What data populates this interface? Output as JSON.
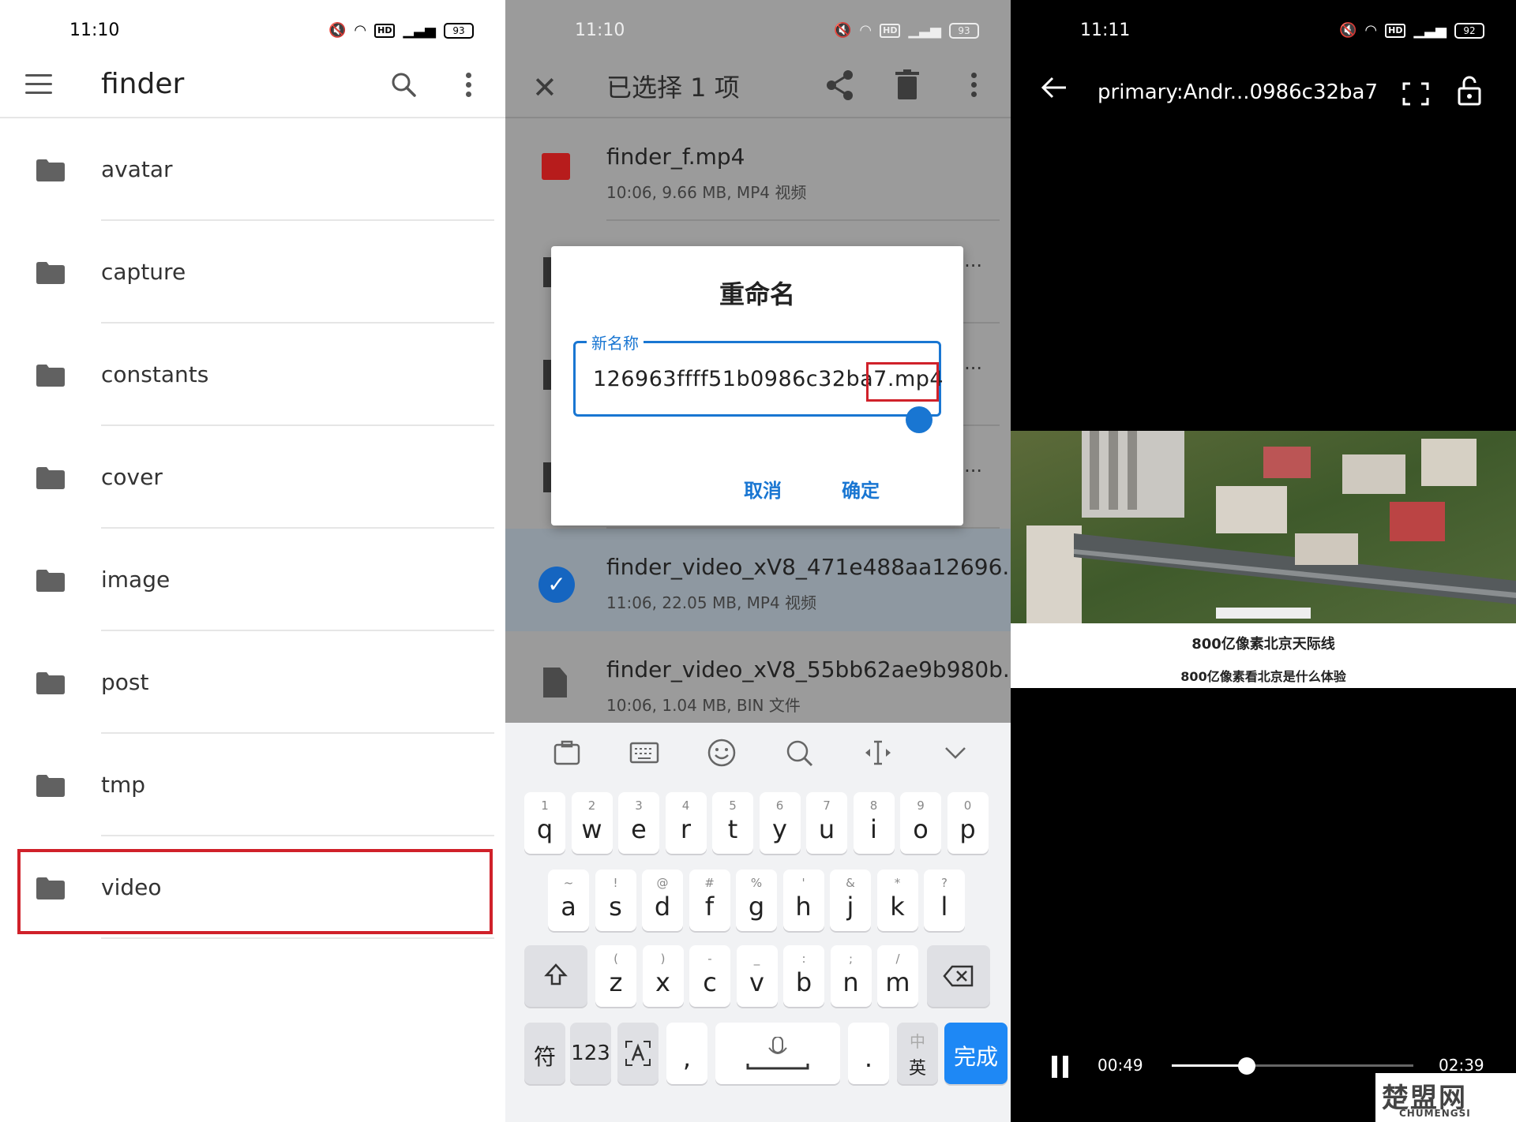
{
  "colors": {
    "accent": "#1976d2",
    "highlight": "#d0212a",
    "done_key": "#1e88f5"
  },
  "left": {
    "status": {
      "time": "11:10",
      "battery": "93"
    },
    "toolbar": {
      "title": "finder",
      "menu_icon": "hamburger-icon",
      "search_icon": "search-icon",
      "more_icon": "more-vert-icon"
    },
    "folders": [
      "avatar",
      "capture",
      "constants",
      "cover",
      "image",
      "post",
      "tmp",
      "video"
    ]
  },
  "middle": {
    "status": {
      "time": "11:10",
      "battery": "93"
    },
    "toolbar": {
      "title": "已选择 1 项"
    },
    "files": [
      {
        "name": "finder_f.mp4",
        "meta": "10:06, 9.66 MB, MP4 视频"
      },
      {
        "name": "finder_video_xV8_471e488aa12696...",
        "meta": "11:06, 22.05 MB, MP4 视频"
      },
      {
        "name": "finder_video_xV8_55bb62ae9b980b...",
        "meta": "10:06, 1.04 MB, BIN 文件"
      }
    ],
    "hidden_truncs": [
      "...",
      "...",
      "7..."
    ],
    "dialog": {
      "title": "重命名",
      "field_label": "新名称",
      "field_value": "126963ffff51b0986c32ba7.mp4",
      "cancel": "取消",
      "ok": "确定"
    },
    "keyboard": {
      "row1": [
        [
          "1",
          "q"
        ],
        [
          "2",
          "w"
        ],
        [
          "3",
          "e"
        ],
        [
          "4",
          "r"
        ],
        [
          "5",
          "t"
        ],
        [
          "6",
          "y"
        ],
        [
          "7",
          "u"
        ],
        [
          "8",
          "i"
        ],
        [
          "9",
          "o"
        ],
        [
          "0",
          "p"
        ]
      ],
      "row2": [
        [
          "~",
          "a"
        ],
        [
          "!",
          "s"
        ],
        [
          "@",
          "d"
        ],
        [
          "#",
          "f"
        ],
        [
          "%",
          "g"
        ],
        [
          "'",
          "h"
        ],
        [
          "&",
          "j"
        ],
        [
          "*",
          "k"
        ],
        [
          "?",
          "l"
        ]
      ],
      "row3": [
        [
          "(",
          "z"
        ],
        [
          ")",
          "x"
        ],
        [
          "-",
          "c"
        ],
        [
          "_",
          "v"
        ],
        [
          ":",
          "b"
        ],
        [
          ";",
          "n"
        ],
        [
          "/",
          "m"
        ]
      ],
      "sym": "符",
      "num": "123",
      "comma": ",",
      "period": ".",
      "lang_top": "中",
      "lang_bottom": "英",
      "done": "完成"
    }
  },
  "right": {
    "status": {
      "time": "11:11",
      "battery": "92"
    },
    "title": "primary:Andr...0986c32ba7",
    "caption1": "800亿像素北京天际线",
    "caption2": "800亿像素看北京是什么体验",
    "current_time": "00:49",
    "total_time": "02:39",
    "progress": 0.31,
    "watermark": "楚盟网",
    "watermark_sub": "CHUMENGSI"
  }
}
